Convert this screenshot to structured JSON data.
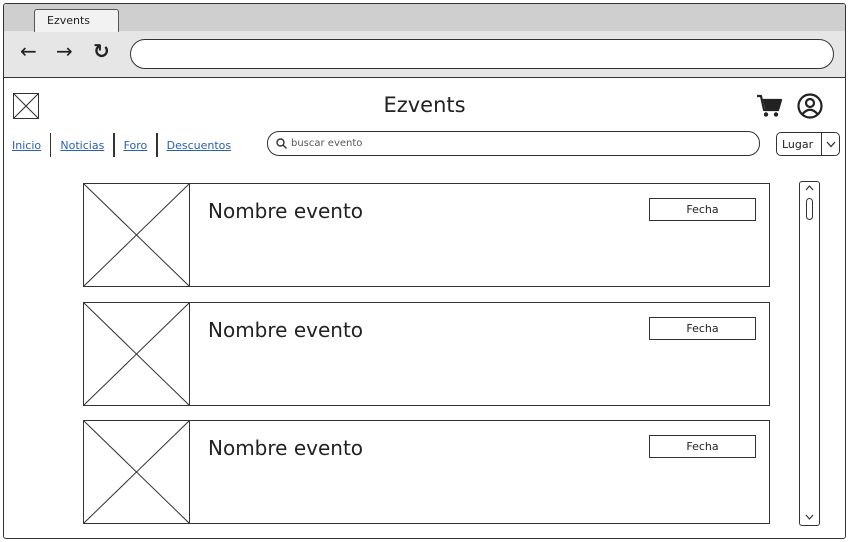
{
  "browser": {
    "tab_title": "Ezvents",
    "url": ""
  },
  "app": {
    "title": "Ezvents"
  },
  "nav": {
    "items": [
      {
        "label": "Inicio"
      },
      {
        "label": "Noticias"
      },
      {
        "label": "Foro"
      },
      {
        "label": "Descuentos"
      }
    ]
  },
  "search": {
    "placeholder": "buscar evento"
  },
  "location_select": {
    "selected": "Lugar"
  },
  "events": [
    {
      "name": "Nombre evento",
      "date": "Fecha"
    },
    {
      "name": "Nombre evento",
      "date": "Fecha"
    },
    {
      "name": "Nombre evento",
      "date": "Fecha"
    }
  ],
  "icons": {
    "back": "arrow-left-icon",
    "forward": "arrow-right-icon",
    "reload": "reload-icon",
    "logo": "logo-placeholder-icon",
    "cart": "cart-icon",
    "account": "user-account-icon",
    "search": "search-icon",
    "dropdown": "chevron-down-icon"
  },
  "colors": {
    "link": "#2860b6",
    "stroke": "#333333",
    "chrome": "#e6e6e6"
  }
}
